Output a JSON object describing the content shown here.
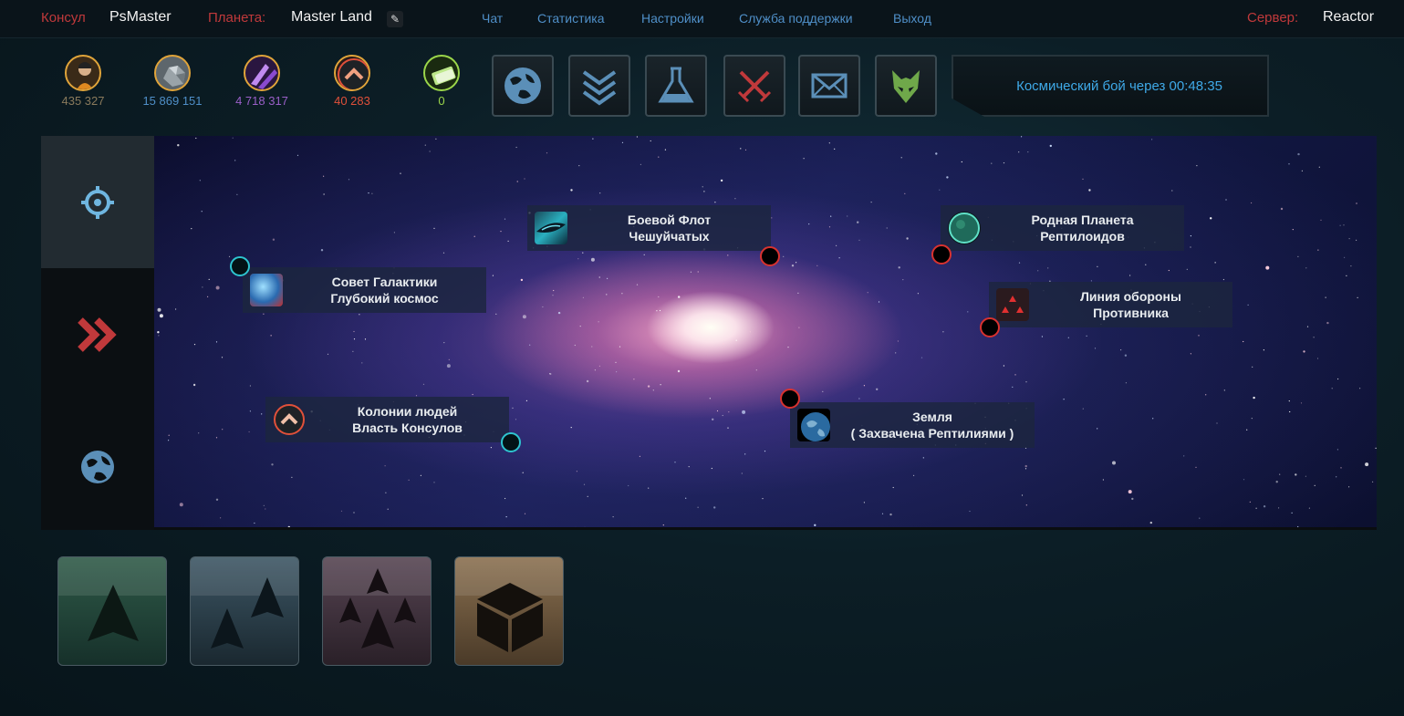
{
  "header": {
    "consul_label": "Консул",
    "consul_name": "PsMaster",
    "planet_label": "Планета:",
    "planet_name": "Master Land",
    "nav": [
      "Чат",
      "Статистика",
      "Настройки",
      "Служба поддержки",
      "Выход"
    ],
    "server_label": "Сервер:",
    "server_name": "Reactor"
  },
  "resources": [
    {
      "value": "435 327",
      "color": "#8a7a5c"
    },
    {
      "value": "15 869 151",
      "color": "#4f8fc8"
    },
    {
      "value": "4 718 317",
      "color": "#9a5fc8"
    },
    {
      "value": "40 283",
      "color": "#e0503a"
    },
    {
      "value": "0",
      "color": "#9bd64a"
    }
  ],
  "toolbar": {
    "icons": [
      "planet-icon",
      "rank-chevrons-icon",
      "flask-icon",
      "crossed-swords-icon",
      "mail-icon",
      "alien-icon"
    ],
    "timer_text": "Космический бой через 00:48:35"
  },
  "side": {
    "icons": [
      "target-icon",
      "double-chevron-right-icon",
      "globe-icon"
    ]
  },
  "map": {
    "locations": [
      {
        "line1": "Совет Галактики",
        "line2": "Глубокий космос"
      },
      {
        "line1": "Боевой Флот",
        "line2": "Чешуйчатых"
      },
      {
        "line1": "Родная Планета",
        "line2": "Рептилоидов"
      },
      {
        "line1": "Линия обороны",
        "line2": "Противника"
      },
      {
        "line1": "Колонии людей",
        "line2": "Власть Консулов"
      },
      {
        "line1": "Земля",
        "line2": "( Захвачена Рептилиями )"
      }
    ]
  },
  "bottom": {
    "buttons": [
      "single-ship-icon",
      "two-ships-icon",
      "fleet-icon",
      "cargo-box-icon"
    ]
  },
  "colors": {
    "accent_red": "#c0393b",
    "link_blue": "#4f8fc8",
    "timer_blue": "#3fa9e8",
    "dot_red": "#d8322f",
    "dot_cyan": "#2ec4cf"
  }
}
